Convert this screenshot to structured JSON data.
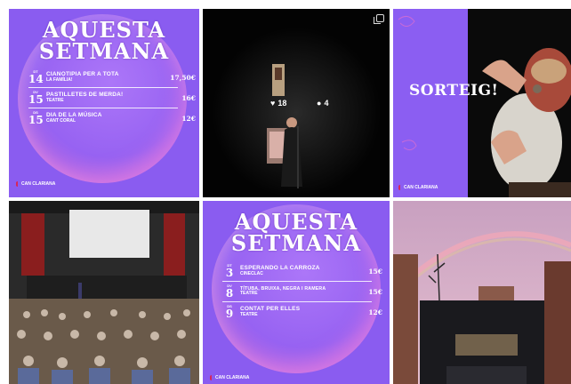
{
  "tiles": {
    "t1": {
      "title_line1": "AQUESTA",
      "title_line2": "SETMANA",
      "events": [
        {
          "day": "DT",
          "num": "14",
          "name": "CIANOTIPIA PER A TOTA",
          "sub": "LA FAMÍLIA!",
          "price": "17,50€"
        },
        {
          "day": "DV",
          "num": "15",
          "name": "PASTILLETES DE MERDA!",
          "sub": "TEATRE",
          "price": "16€"
        },
        {
          "day": "DS",
          "num": "15",
          "name": "DIA DE LA MÚSICA",
          "sub": "CANT CORAL",
          "price": "12€"
        }
      ],
      "logo": "CAN CLARIANA"
    },
    "t2": {
      "likes": "18",
      "comments": "4"
    },
    "t3": {
      "text": "SORTEIG!",
      "logo": "CAN CLARIANA"
    },
    "t5": {
      "title_line1": "AQUESTA",
      "title_line2": "SETMANA",
      "events": [
        {
          "day": "DT",
          "num": "3",
          "name": "ESPERANDO LA CARROZA",
          "sub": "CINECLAC",
          "price": "15€"
        },
        {
          "day": "DV",
          "num": "8",
          "name": "TÍTUBA, BRUIXA, NEGRA I RAMERA",
          "sub": "TEATRE",
          "price": "15€"
        },
        {
          "day": "DS",
          "num": "9",
          "name": "CONTAT PER ELLES",
          "sub": "TEATRE",
          "price": "12€"
        }
      ],
      "logo": "CAN CLARIANA"
    }
  },
  "colors": {
    "poster_purple": "#8a5cf0",
    "logo_red": "#d6265a"
  }
}
